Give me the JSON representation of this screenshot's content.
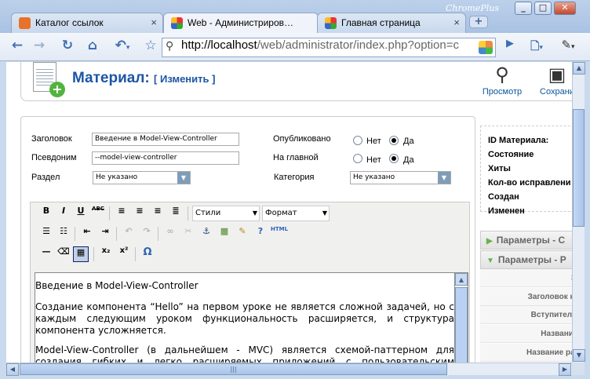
{
  "browser": {
    "brand": "ChromePlus",
    "tabs": [
      {
        "title": "Каталог ссылок",
        "favicon": "joomla-icon",
        "active": false
      },
      {
        "title": "Web - Администриров…",
        "favicon": "joomla-icon",
        "active": true
      },
      {
        "title": "Главная страница",
        "favicon": "joomla-icon",
        "active": false
      }
    ],
    "new_tab": "+",
    "window_buttons": {
      "minimize": "_",
      "maximize": "□",
      "close": "✕"
    },
    "url_host": "http://localhost",
    "url_path": "/web/administrator/index.php?option=c",
    "icons": {
      "back": "back-arrow-icon",
      "forward": "forward-arrow-icon",
      "reload": "reload-icon",
      "home": "home-icon",
      "undo": "undo-close-tab-icon",
      "bookmark": "star-icon",
      "search": "magnifier-icon",
      "extension": "extension-icon",
      "go": "play-icon",
      "page": "page-menu-icon",
      "tools": "wrench-icon"
    }
  },
  "header": {
    "title": "Материал:",
    "subtitle": "[ Изменить ]",
    "tools": [
      {
        "label": "Просмотр",
        "icon": "preview-magnifier-icon"
      },
      {
        "label": "Сохрани",
        "icon": "save-disk-icon"
      }
    ]
  },
  "form": {
    "title_label": "Заголовок",
    "title_value": "Введение в Model-View-Controller",
    "alias_label": "Псевдоним",
    "alias_value": "--model-view-controller",
    "section_label": "Раздел",
    "section_value": "Не указано",
    "published_label": "Опубликовано",
    "frontpage_label": "На главной",
    "category_label": "Категория",
    "category_value": "Не указано",
    "no": "Нет",
    "yes": "Да",
    "published": "Да",
    "frontpage": "Да"
  },
  "editor": {
    "styles_select": "Стили",
    "format_select": "Формат",
    "buttons": [
      "bold-icon",
      "italic-icon",
      "underline-icon",
      "strikethrough-icon",
      "align-left-icon",
      "align-center-icon",
      "align-right-icon",
      "align-justify-icon",
      "bullet-list-icon",
      "numbered-list-icon",
      "outdent-icon",
      "indent-icon",
      "undo-icon",
      "redo-icon",
      "link-icon",
      "unlink-icon",
      "anchor-icon",
      "image-icon",
      "cleanup-icon",
      "help-icon",
      "html-icon",
      "hr-icon",
      "eraser-icon",
      "table-icon",
      "subscript-icon",
      "superscript-icon",
      "omega-icon"
    ],
    "labels": {
      "bold": "B",
      "italic": "I",
      "underline": "U",
      "strike": "ABC",
      "html": "HTML",
      "sub": "x₂",
      "sup": "x²",
      "omega": "Ω"
    },
    "paragraphs": [
      "Введение в Model-View-Controller",
      "Создание компонента “Hello” на первом уроке не является сложной задачей, но с каждым следующим уроком функциональность расширяется, и структура компонента усложняется.",
      "Model-View-Controller (в дальнейшем - MVC) является схемой-паттерном для создания гибких и легко расширяемых приложений с пользовательским интерфейсом. Эта схема"
    ]
  },
  "sidebar": {
    "info_labels": [
      "ID Материала:",
      "Состояние",
      "Хиты",
      "Кол-во исправлени",
      "Создан",
      "Изменен"
    ],
    "panes": [
      {
        "label": "Параметры - С",
        "expanded": false
      },
      {
        "label": "Параметры - Р",
        "expanded": true
      }
    ],
    "param_rows": [
      "Загол",
      "Заголовок как сс",
      "Вступительный",
      "Название раз",
      "Название раздел"
    ]
  },
  "colors": {
    "title_blue": "#1c55a4",
    "link_blue": "#0b5599",
    "pane_green": "#6ab04c"
  }
}
